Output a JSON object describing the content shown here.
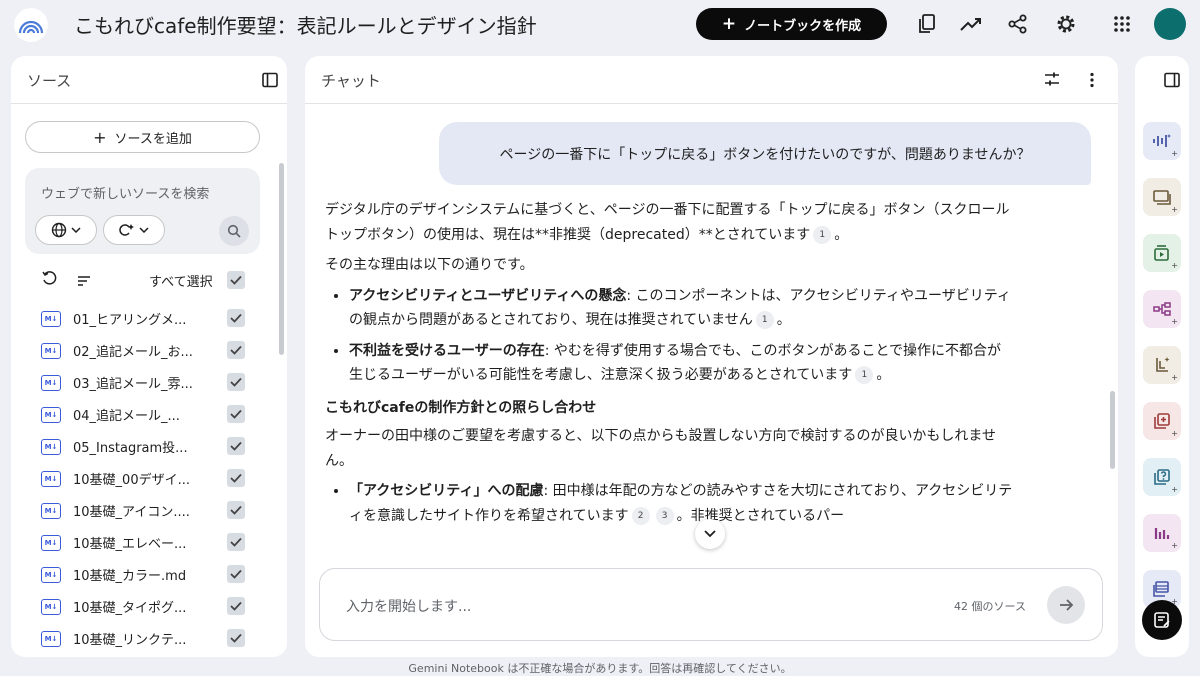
{
  "app": {
    "title": "こもれびcafe制作要望：表記ルールとデザイン指針",
    "create_notebook_label": "ノートブックを作成"
  },
  "sources_panel": {
    "title": "ソース",
    "add_source_label": "ソースを追加",
    "search_placeholder": "ウェブで新しいソースを検索",
    "select_all_label": "すべて選択",
    "items": [
      {
        "name": "01_ヒアリングメ..."
      },
      {
        "name": "02_追記メール_お..."
      },
      {
        "name": "03_追記メール_雰..."
      },
      {
        "name": "04_追記メール_..."
      },
      {
        "name": "05_Instagram投..."
      },
      {
        "name": "10基礎_00デザイ..."
      },
      {
        "name": "10基礎_アイコン...."
      },
      {
        "name": "10基礎_エレベー..."
      },
      {
        "name": "10基礎_カラー.md"
      },
      {
        "name": "10基礎_タイポグ..."
      },
      {
        "name": "10基礎_リンクテ..."
      }
    ]
  },
  "chat_panel": {
    "title": "チャット",
    "user_message": "ページの一番下に「トップに戻る」ボタンを付けたいのですが、問題ありませんか？",
    "response": {
      "p1": "デジタル庁のデザインシステムに基づくと、ページの一番下に配置する「トップに戻る」ボタン（スクロールトップボタン）の使用は、現在は**非推奨（deprecated）**とされています",
      "p1_ref": "1",
      "p1_end": "。",
      "p2": "その主な理由は以下の通りです。",
      "b1_title": "アクセシビリティとユーザビリティへの懸念",
      "b1_text": ": このコンポーネントは、アクセシビリティやユーザビリティの観点から問題があるとされており、現在は推奨されていません",
      "b1_ref": "1",
      "b1_end": "。",
      "b2_title": "不利益を受けるユーザーの存在",
      "b2_text": ": やむを得ず使用する場合でも、このボタンがあることで操作に不都合が生じるユーザーがいる可能性を考慮し、注意深く扱う必要があるとされています",
      "b2_ref": "1",
      "b2_end": "。",
      "h1": "こもれびcafeの制作方針との照らし合わせ",
      "p3": "オーナーの田中様のご要望を考慮すると、以下の点からも設置しない方向で検討するのが良いかもしれません。",
      "b3_title": "「アクセシビリティ」への配慮",
      "b3_text": ": 田中様は年配の方などの読みやすさを大切にされており、アクセシビリティを意識したサイト作りを希望されています",
      "b3_ref1": "2",
      "b3_ref2": "3",
      "b3_end": "。非推奨とされているパー"
    },
    "input_placeholder": "入力を開始します...",
    "source_count": "42 個のソース"
  },
  "disclaimer": "Gemini Notebook は不正確な場合があります。回答は再確認してください。",
  "colors": {
    "accent_dark": "#0b0b0b",
    "avatar": "#0d6e6e",
    "link_blue": "#3b5bdb",
    "background": "#eef0f6"
  }
}
